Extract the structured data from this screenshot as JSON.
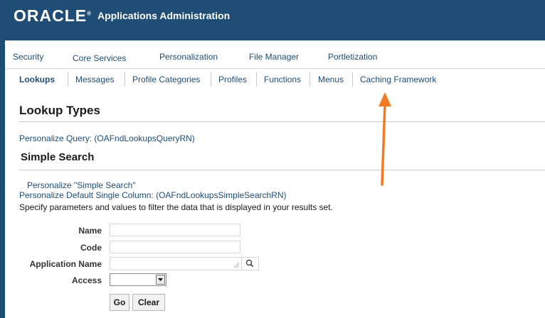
{
  "header": {
    "logo": "ORACLE",
    "logo_mark": "®",
    "title": "Applications Administration"
  },
  "tabs": [
    {
      "label": "Security"
    },
    {
      "label": "Core Services"
    },
    {
      "label": "Personalization"
    },
    {
      "label": "File Manager"
    },
    {
      "label": "Portletization"
    }
  ],
  "subtabs": [
    {
      "label": "Lookups"
    },
    {
      "label": "Messages"
    },
    {
      "label": "Profile Categories"
    },
    {
      "label": "Profiles"
    },
    {
      "label": "Functions"
    },
    {
      "label": "Menus"
    },
    {
      "label": "Caching Framework"
    }
  ],
  "page": {
    "title": "Lookup Types",
    "personalize_query": "Personalize Query: (OAFndLookupsQueryRN)"
  },
  "search": {
    "title": "Simple Search",
    "personalize_simple": "Personalize \"Simple Search\"",
    "personalize_column": "Personalize Default Single Column: (OAFndLookupsSimpleSearchRN)",
    "instruction": "Specify parameters and values to filter the data that is displayed in your results set.",
    "fields": {
      "name_label": "Name",
      "name_value": "",
      "code_label": "Code",
      "code_value": "",
      "application_label": "Application Name",
      "application_value": "",
      "access_label": "Access",
      "access_value": ""
    },
    "go_label": "Go",
    "clear_label": "Clear"
  },
  "icons": {
    "search": "search-icon",
    "dropdown": "chevron-down-icon",
    "annotation": "arrow-icon"
  },
  "colors": {
    "header_bg": "#1f4d76",
    "link": "#1f4d76",
    "annotation_arrow": "#f47920"
  }
}
